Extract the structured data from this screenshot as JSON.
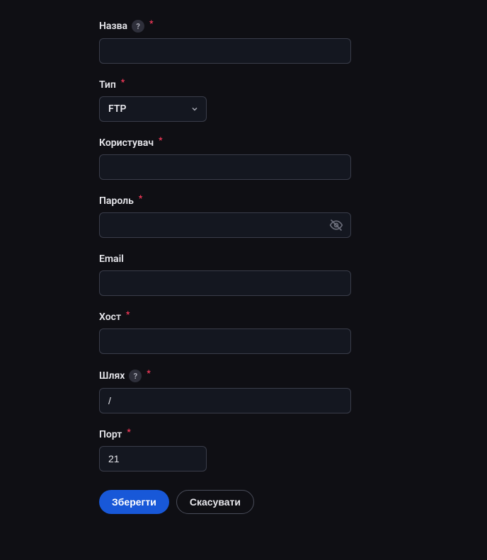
{
  "fields": {
    "name": {
      "label": "Назва",
      "value": "",
      "required": true,
      "help": true
    },
    "type": {
      "label": "Тип",
      "value": "FTP",
      "required": true
    },
    "user": {
      "label": "Користувач",
      "value": "",
      "required": true
    },
    "password": {
      "label": "Пароль",
      "value": "",
      "required": true
    },
    "email": {
      "label": "Email",
      "value": "",
      "required": false
    },
    "host": {
      "label": "Хост",
      "value": "",
      "required": true
    },
    "path": {
      "label": "Шлях",
      "value": "/",
      "required": true,
      "help": true
    },
    "port": {
      "label": "Порт",
      "value": "21",
      "required": true
    }
  },
  "help_symbol": "?",
  "req_symbol": "*",
  "buttons": {
    "save": "Зберегти",
    "cancel": "Скасувати"
  }
}
